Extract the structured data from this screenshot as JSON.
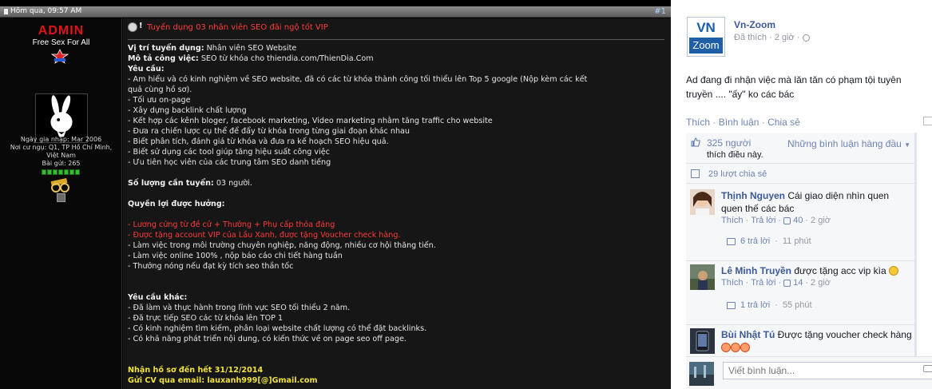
{
  "forum": {
    "post_date": "Hôm qua, 09:57 AM",
    "post_number": "#1",
    "user": {
      "name": "ADMIN",
      "title": "Free Sex For All",
      "join_date": "Ngày gia nhập: Mar 2006",
      "location": "Nơi cư ngụ: Q1, TP Hồ Chí Minh, Việt Nam",
      "posts": "Bài gửi: 265"
    },
    "post_title": "Tuyển dụng 03 nhân viên SEO đãi ngộ tốt VIP",
    "lines": [
      {
        "label": "Vị trí tuyển dụng:",
        "text": " Nhân viên SEO Website"
      },
      {
        "label": "Mô tả công việc:",
        "text": " SEO từ khóa cho thiendia.com/ThienDia.Com"
      },
      {
        "label": "Yêu cầu:",
        "text": ""
      },
      {
        "text": "- Am hiểu và có kinh nghiệm về SEO website, đã có các từ khóa thành công tối thiểu lên Top 5 google (Nộp kèm các kết"
      },
      {
        "text": "quả cùng hồ sơ)."
      },
      {
        "text": "- Tối ưu on-page"
      },
      {
        "text": "- Xây dựng backlink chất lượng"
      },
      {
        "text": "- Kết hợp các kênh bloger, facebook marketing, Video marketing nhằm tăng traffic cho website"
      },
      {
        "text": "- Đưa ra chiến lược cụ thể để đẩy từ khóa trong từng giai đoạn khác nhau"
      },
      {
        "text": "- Biết phân tích, đánh giá từ khóa và đưa ra kế hoạch SEO hiệu quả."
      },
      {
        "text": "- Biết sử dụng các tool giúp tăng hiệu suất công việc"
      },
      {
        "text": "- Ưu tiên học viên của các trung tâm SEO danh tiếng"
      },
      {
        "gap": true
      },
      {
        "label": "Số lượng cần tuyển:",
        "text": " 03 người."
      },
      {
        "gap": true
      },
      {
        "label": "Quyền lợi được hưởng:",
        "text": ""
      },
      {
        "gap": true
      },
      {
        "red": "- Lương cứng từ đề cử + Thưởng + Phụ cấp thỏa đáng"
      },
      {
        "red": "- Được tặng account VIP của Lầu Xanh, được tặng Voucher check hàng."
      },
      {
        "text": "- Làm việc trong môi trường chuyên nghiệp, năng động, nhiều cơ hội thăng tiến."
      },
      {
        "text": "- Làm việc online 100% , nộp báo cáo chi tiết hàng tuần"
      },
      {
        "text": "- Thưởng nóng nếu đạt kỳ tích seo thần tốc"
      },
      {
        "gap": true
      },
      {
        "gap": true
      },
      {
        "label": "Yêu cầu khác:",
        "text": ""
      },
      {
        "text": "- Đã làm và thực hành trong lĩnh vực SEO tối thiểu 2 năm."
      },
      {
        "text": "- Đã trực tiếp SEO các từ khóa lên TOP 1"
      },
      {
        "text": "- Có kinh nghiệm tìm kiếm, phân loại website chất lượng có thể đặt backlinks."
      },
      {
        "text": "- Có khả năng phát triển nội dung, có kiến thức về on page seo off page."
      },
      {
        "gap": true
      },
      {
        "gap": true
      },
      {
        "yellow": "Nhận hồ sơ đến hết 31/12/2014"
      },
      {
        "yellow": "Gửi CV qua email: lauxanh999[@]Gmail.com"
      }
    ]
  },
  "facebook": {
    "page_name": "Vn-Zoom",
    "logo_top": "VN",
    "logo_bottom": "Zoom",
    "page_meta": "Đã thích · 2 giờ ·",
    "status": "Ad đang đi nhận việc mà lăn tăn có phạm tội tuyên truyền .... \"ấy\" ko các bác",
    "actions": {
      "like": "Thích",
      "comment": "Bình luận",
      "share": "Chia sẻ"
    },
    "likes_count": "325 người",
    "likes_text": "thích điều này.",
    "order_label": "Những bình luận hàng đầu",
    "shares_text": "29 lượt chia sẻ",
    "comments": [
      {
        "author": "Thịnh Nguyen",
        "text": " Cái giao diện nhìn quen quen thế các bác",
        "like": "Thích",
        "reply": "Trả lời",
        "likes": "40",
        "time": "2 giờ",
        "replies": "6 trả lời",
        "replies_time": "11 phút"
      },
      {
        "author": "Lê Minh Truyền",
        "text": " được tặng acc vip kìa",
        "like": "Thích",
        "reply": "Trả lời",
        "likes": "14",
        "time": "2 giờ",
        "replies": "1 trả lời",
        "replies_time": "55 phút"
      },
      {
        "author": "Bùi Nhật Tú",
        "text": " Được tặng voucher check hàng"
      }
    ],
    "composer_placeholder": "Viết bình luận..."
  }
}
